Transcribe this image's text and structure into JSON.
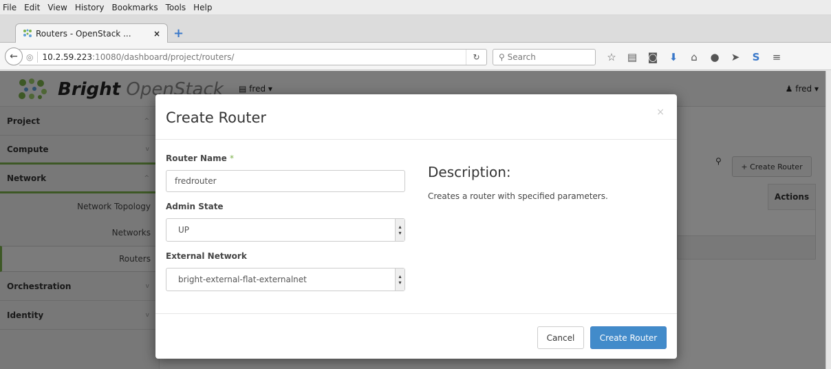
{
  "menubar": [
    "File",
    "Edit",
    "View",
    "History",
    "Bookmarks",
    "Tools",
    "Help"
  ],
  "tab": {
    "title": "Routers - OpenStack ...",
    "close": "×",
    "newtab": "+"
  },
  "url": {
    "host": "10.2.59.223",
    "path": ":10080/dashboard/project/routers/"
  },
  "search": {
    "placeholder": "Search"
  },
  "toolbar_icons": [
    "bookmark-star-icon",
    "reading-list-icon",
    "pocket-icon",
    "download-icon",
    "home-icon",
    "chat-icon",
    "send-icon",
    "s-extension-icon",
    "menu-icon"
  ],
  "header": {
    "brand_bold": "Bright",
    "brand_thin": "OpenStack",
    "project": "fred",
    "user": "fred"
  },
  "sidebar": {
    "project": "Project",
    "compute": "Compute",
    "network": "Network",
    "items": [
      "Network Topology",
      "Networks",
      "Routers"
    ],
    "orchestration": "Orchestration",
    "identity": "Identity"
  },
  "background": {
    "create_router": "Create Router",
    "actions": "Actions"
  },
  "modal": {
    "title": "Create Router",
    "close": "×",
    "router_name_label": "Router Name",
    "required_mark": "*",
    "router_name_value": "fredrouter",
    "admin_state_label": "Admin State",
    "admin_state_value": "UP",
    "external_network_label": "External Network",
    "external_network_value": "bright-external-flat-externalnet",
    "description_title": "Description:",
    "description_text": "Creates a router with specified parameters.",
    "cancel": "Cancel",
    "submit": "Create Router"
  },
  "colors": {
    "accent": "#7bb04a",
    "primary": "#428bca"
  }
}
